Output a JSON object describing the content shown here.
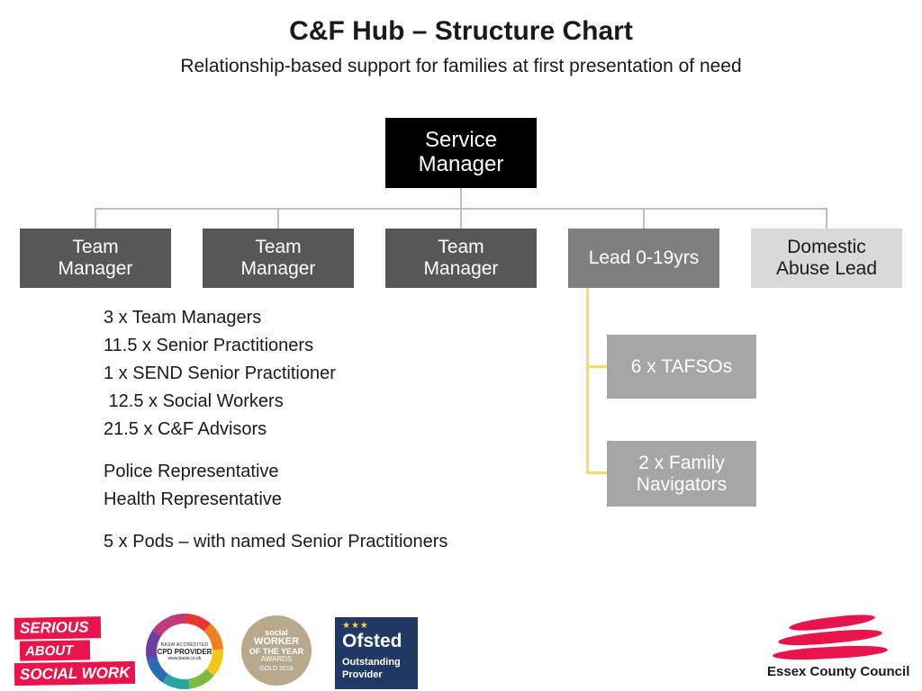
{
  "header": {
    "title": "C&F Hub – Structure Chart",
    "subtitle": "Relationship-based support for families at first presentation of need"
  },
  "chart": {
    "nodes": [
      {
        "id": "service-manager",
        "label": "Service Manager",
        "line1": "Service",
        "line2": "Manager",
        "color": "#000000",
        "text_color": "#ffffff"
      },
      {
        "id": "team-manager-1",
        "label": "Team Manager",
        "line1": "Team",
        "line2": "Manager",
        "color": "#575757",
        "text_color": "#ffffff"
      },
      {
        "id": "team-manager-2",
        "label": "Team Manager",
        "line1": "Team",
        "line2": "Manager",
        "color": "#575757",
        "text_color": "#ffffff"
      },
      {
        "id": "team-manager-3",
        "label": "Team Manager",
        "line1": "Team",
        "line2": "Manager",
        "color": "#575757",
        "text_color": "#ffffff"
      },
      {
        "id": "lead-0-19",
        "label": "Lead 0-19yrs",
        "line1": "Lead 0-19yrs",
        "line2": "",
        "color": "#7f7f7f",
        "text_color": "#ffffff"
      },
      {
        "id": "domestic-abuse-lead",
        "label": "Domestic Abuse Lead",
        "line1": "Domestic",
        "line2": "Abuse Lead",
        "color": "#d9d9d9",
        "text_color": "#1a1a1a"
      },
      {
        "id": "tafsos",
        "label": "6 x TAFSOs",
        "line1": "6 x TAFSOs",
        "line2": "",
        "color": "#a6a6a6",
        "text_color": "#ffffff"
      },
      {
        "id": "family-navigators",
        "label": "2 x Family Navigators",
        "line1": "2 x Family",
        "line2": "Navigators",
        "color": "#a6a6a6",
        "text_color": "#ffffff"
      }
    ],
    "connector_color": "#bfbfbf",
    "connector_color_secondary": "#ffd966"
  },
  "details": {
    "lines": [
      "3 x Team Managers",
      "11.5 x Senior Practitioners",
      "1 x SEND Senior Practitioner",
      " 12.5 x Social Workers",
      "21.5 x C&F Advisors"
    ],
    "reps": [
      "Police Representative",
      "Health Representative"
    ],
    "pods": "5 x Pods – with named Senior Practitioners"
  },
  "logos": {
    "serious_about_social_work": {
      "line1": "SERIOUS",
      "line2": "ABOUT",
      "line3": "SOCIAL WORK",
      "color": "#e8144b"
    },
    "cpd_provider": {
      "top": "BASW ACCREDITED",
      "mid": "CPD PROVIDER",
      "bottom": "www.basw.co.uk"
    },
    "social_worker_awards": {
      "line1": "social",
      "line2": "WORKER",
      "line3": "OF THE YEAR",
      "line4": "AWARDS",
      "line5": "GOLD 2018"
    },
    "ofsted": {
      "stars": "★★★",
      "name": "Ofsted",
      "line1": "Outstanding",
      "line2": "Provider"
    },
    "essex_county_council": {
      "text": "Essex County Council",
      "color": "#e8144b"
    }
  }
}
